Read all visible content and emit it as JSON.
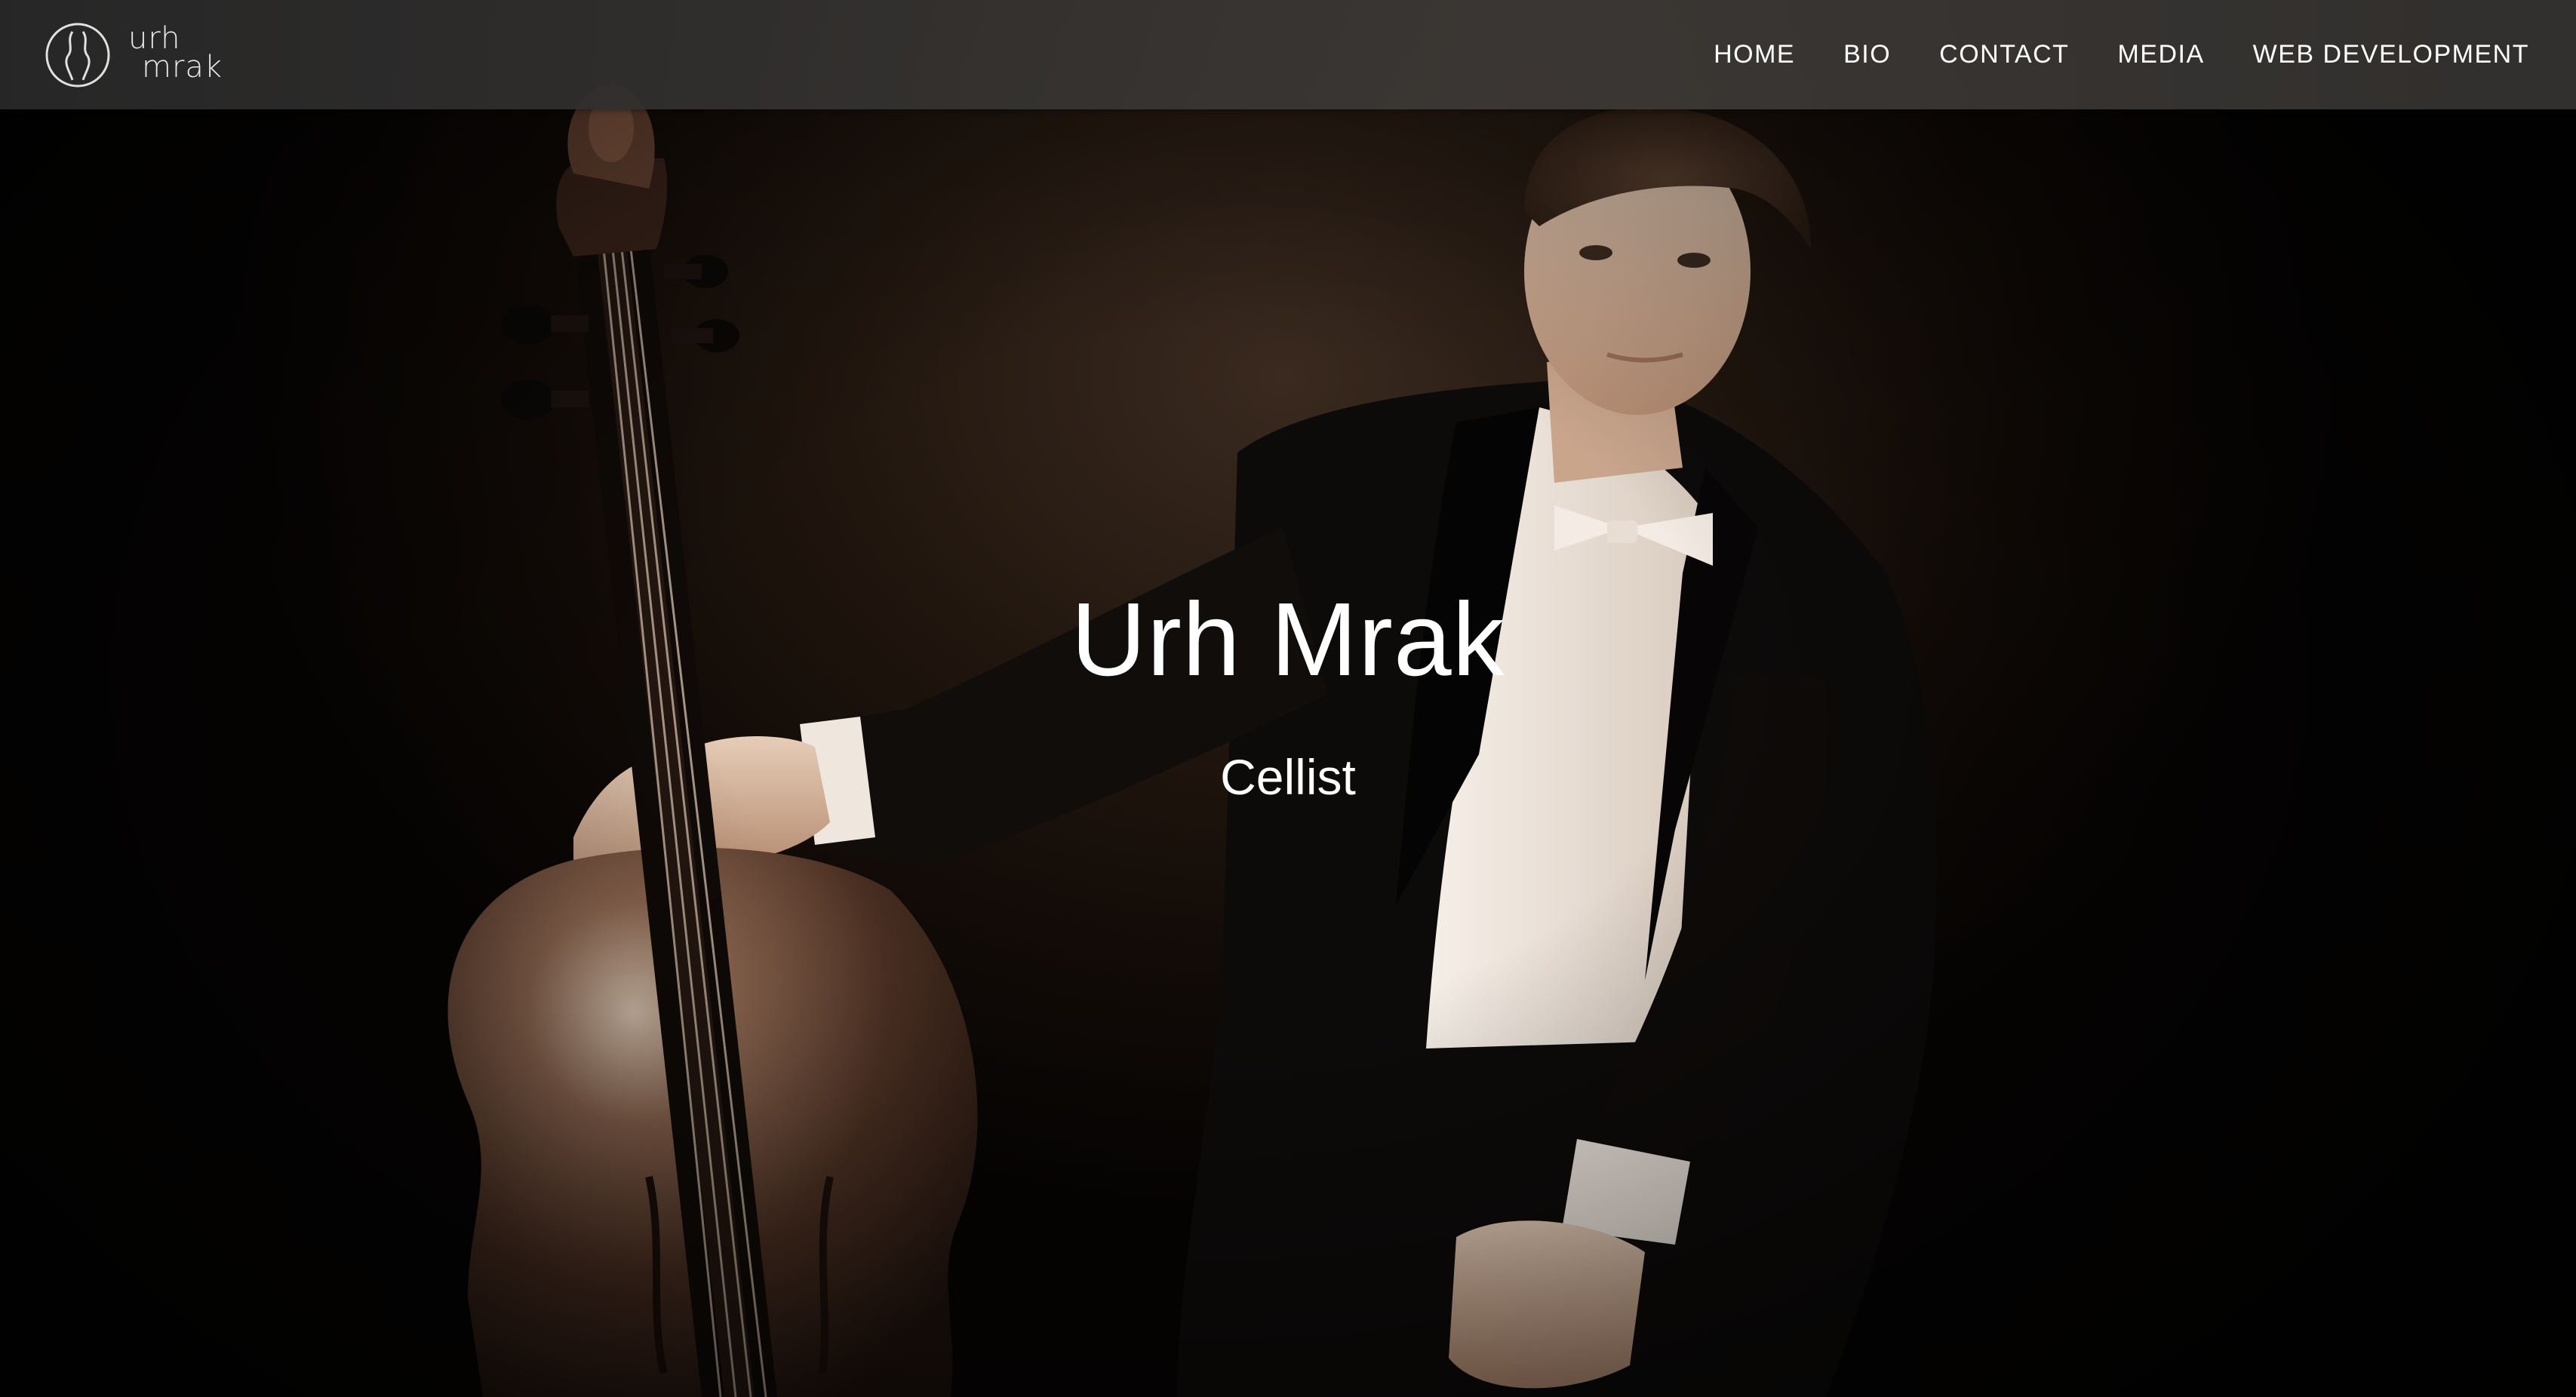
{
  "brand": {
    "logo_line1": "urh",
    "logo_line2": "mrak",
    "logo_icon": "cello-circle-icon"
  },
  "nav": {
    "items": [
      {
        "label": "HOME"
      },
      {
        "label": "BIO"
      },
      {
        "label": "CONTACT"
      },
      {
        "label": "MEDIA"
      },
      {
        "label": "WEB DEVELOPMENT"
      }
    ]
  },
  "hero": {
    "title": "Urh Mrak",
    "subtitle": "Cellist"
  },
  "colors": {
    "nav_text": "#ffffff",
    "hero_text": "#ffffff",
    "background_dark": "#0b0705",
    "photo_tone_warm": "#3a2a20"
  }
}
